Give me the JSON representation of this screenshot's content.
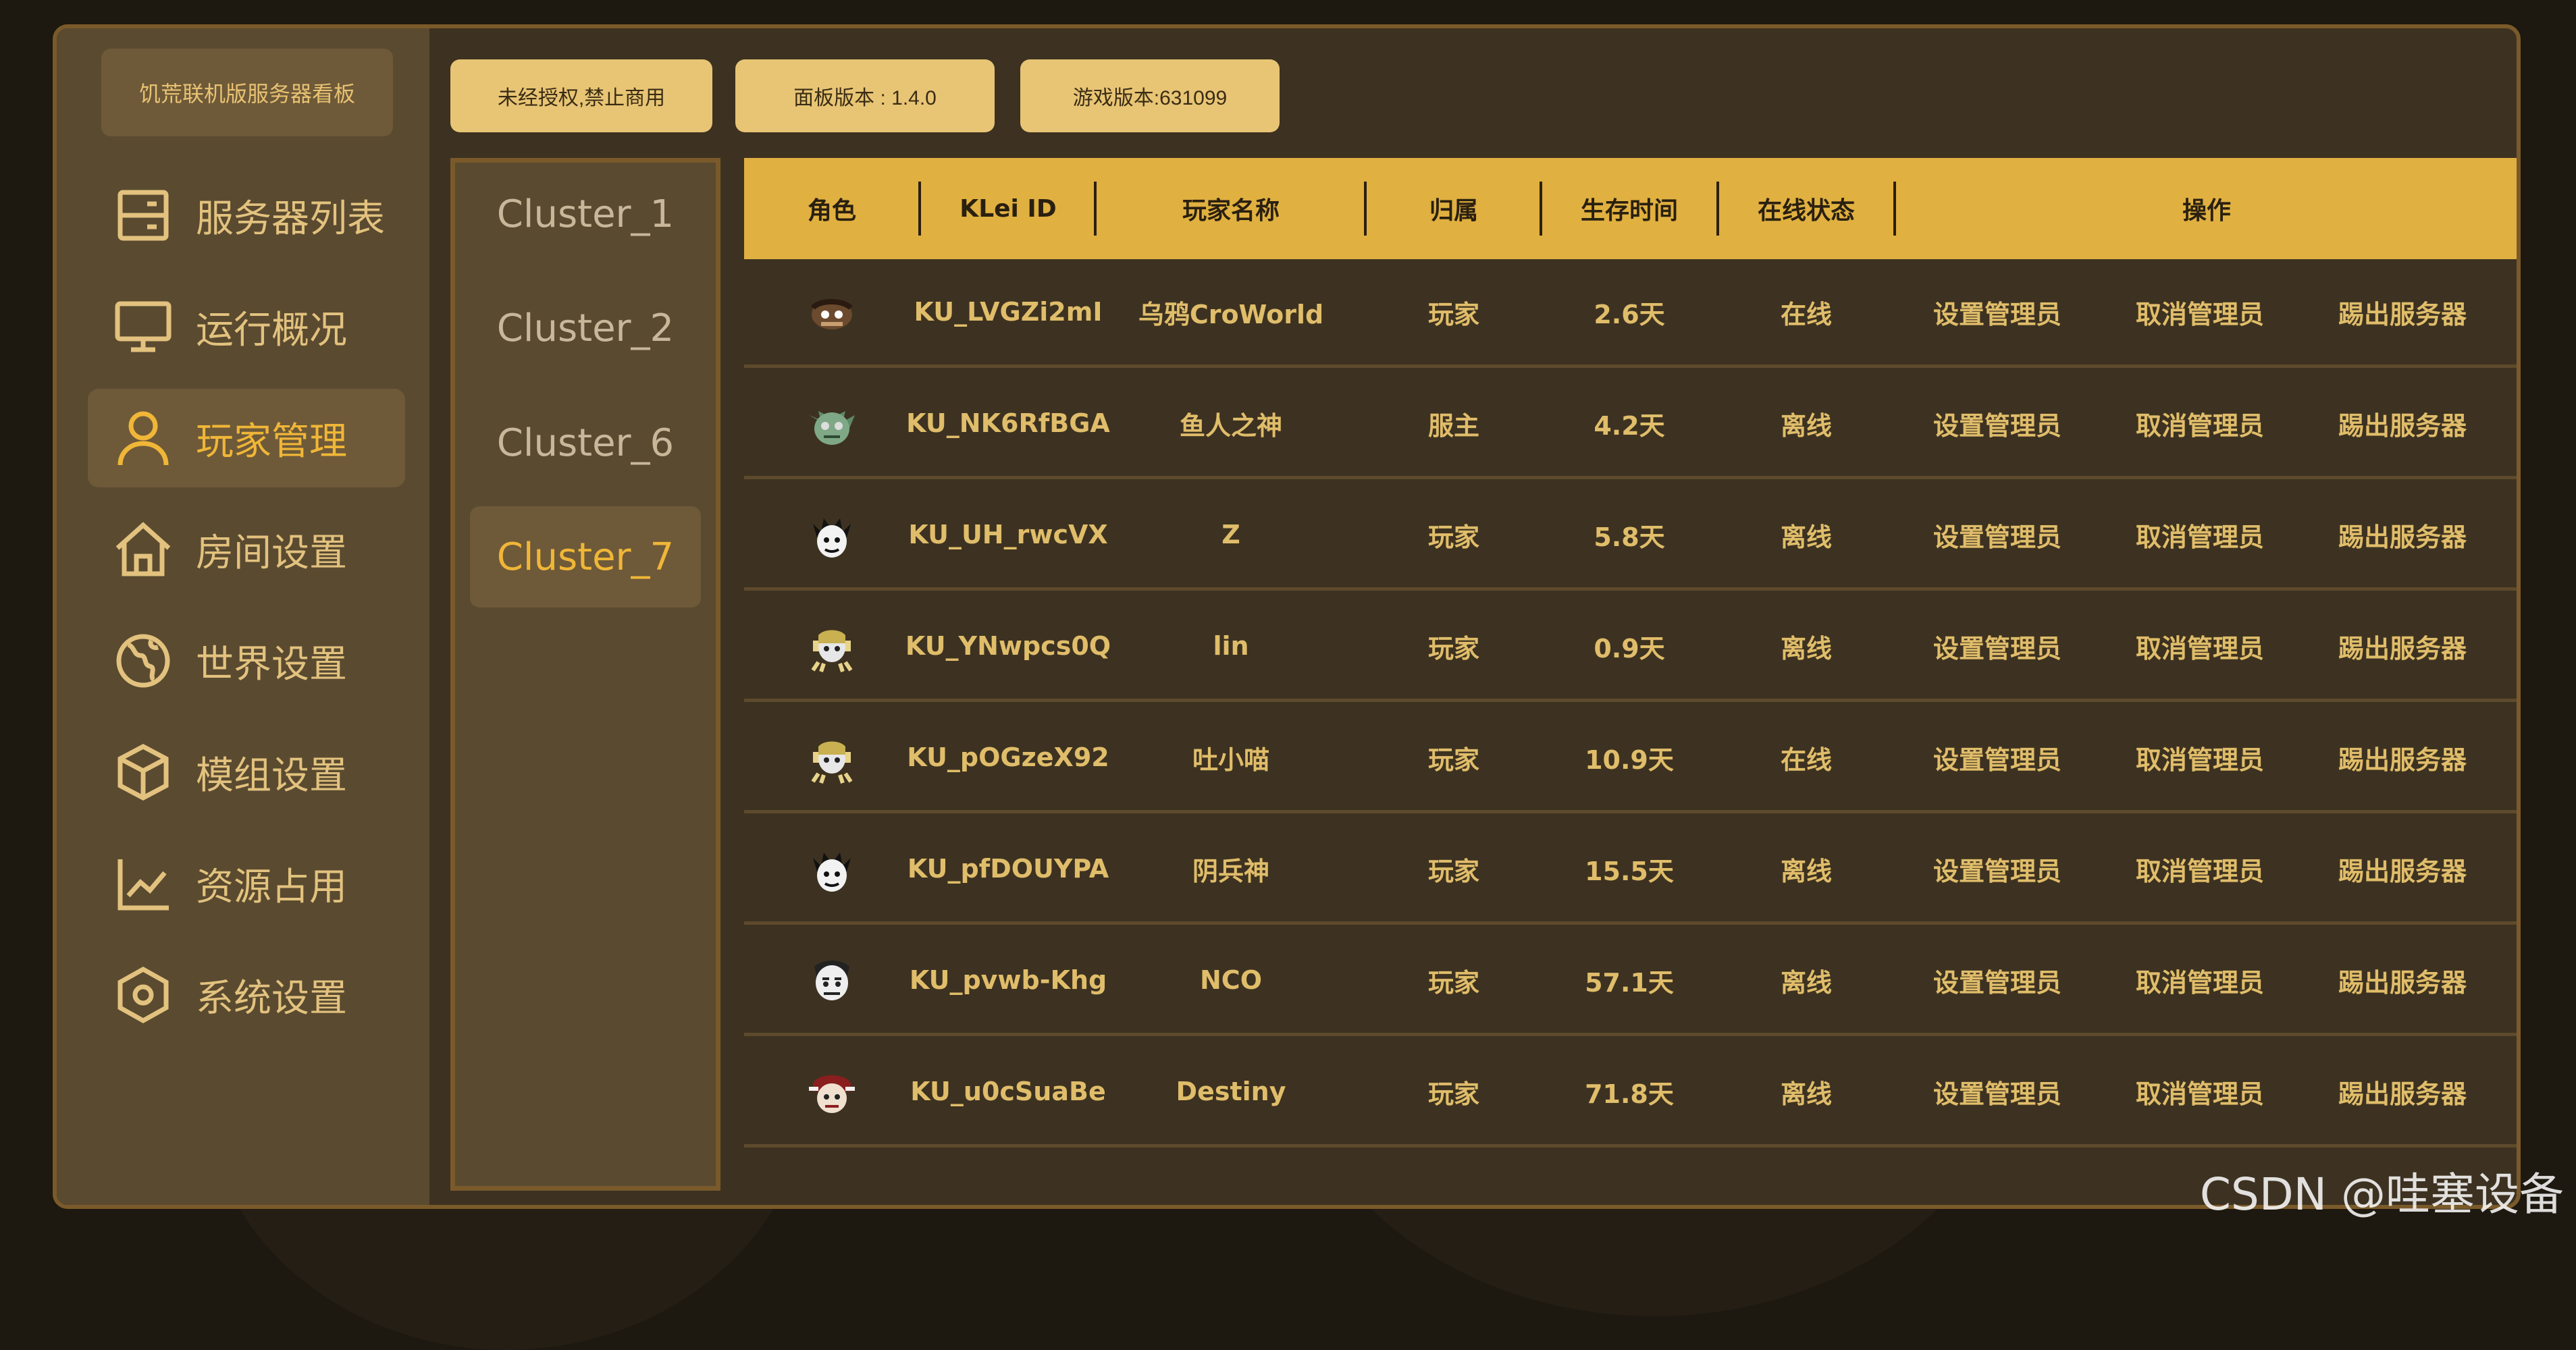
{
  "brand": "饥荒联机版服务器看板",
  "nav": [
    {
      "label": "服务器列表",
      "icon": "server-icon"
    },
    {
      "label": "运行概况",
      "icon": "monitor-icon"
    },
    {
      "label": "玩家管理",
      "icon": "user-icon"
    },
    {
      "label": "房间设置",
      "icon": "home-icon"
    },
    {
      "label": "世界设置",
      "icon": "globe-icon"
    },
    {
      "label": "模组设置",
      "icon": "cube-icon"
    },
    {
      "label": "资源占用",
      "icon": "chart-icon"
    },
    {
      "label": "系统设置",
      "icon": "gear-icon"
    }
  ],
  "active_nav": "玩家管理",
  "top_buttons": [
    "未经授权,禁止商用",
    "面板版本 : 1.4.0",
    "游戏版本:631099"
  ],
  "clusters": [
    "Cluster_1",
    "Cluster_2",
    "Cluster_6",
    "Cluster_7"
  ],
  "active_cluster": "Cluster_7",
  "table": {
    "headers": [
      "角色",
      "KLei ID",
      "玩家名称",
      "归属",
      "生存时间",
      "在线状态",
      "操作"
    ],
    "rows": [
      {
        "avatar": "crow-avatar-icon",
        "klei_id": "KU_LVGZi2mI",
        "name": "乌鸦CroWorld",
        "role": "玩家",
        "survival": "2.6天",
        "status": "在线"
      },
      {
        "avatar": "merm-avatar-icon",
        "klei_id": "KU_NK6RfBGA",
        "name": "鱼人之神",
        "role": "服主",
        "survival": "4.2天",
        "status": "离线"
      },
      {
        "avatar": "wilson-avatar-icon",
        "klei_id": "KU_UH_rwcVX",
        "name": "Z",
        "role": "玩家",
        "survival": "5.8天",
        "status": "离线"
      },
      {
        "avatar": "wendy-avatar-icon",
        "klei_id": "KU_YNwpcs0Q",
        "name": "lin",
        "role": "玩家",
        "survival": "0.9天",
        "status": "离线"
      },
      {
        "avatar": "wendy-avatar-icon",
        "klei_id": "KU_pOGzeX92",
        "name": "吐小喵",
        "role": "玩家",
        "survival": "10.9天",
        "status": "在线"
      },
      {
        "avatar": "wilson-avatar-icon",
        "klei_id": "KU_pfDOUYPA",
        "name": "阴兵神",
        "role": "玩家",
        "survival": "15.5天",
        "status": "离线"
      },
      {
        "avatar": "maxwell-avatar-icon",
        "klei_id": "KU_pvwb-Khg",
        "name": "NCO",
        "role": "玩家",
        "survival": "57.1天",
        "status": "离线"
      },
      {
        "avatar": "wigfrid-avatar-icon",
        "klei_id": "KU_u0cSuaBe",
        "name": "Destiny",
        "role": "玩家",
        "survival": "71.8天",
        "status": "离线"
      }
    ],
    "actions": [
      "设置管理员",
      "取消管理员",
      "踢出服务器"
    ]
  },
  "watermark": "CSDN @哇塞设备",
  "colors": {
    "accent": "#f0b637",
    "header": "#e0b040",
    "panel": "#5a4a30",
    "button": "#e8c575"
  }
}
